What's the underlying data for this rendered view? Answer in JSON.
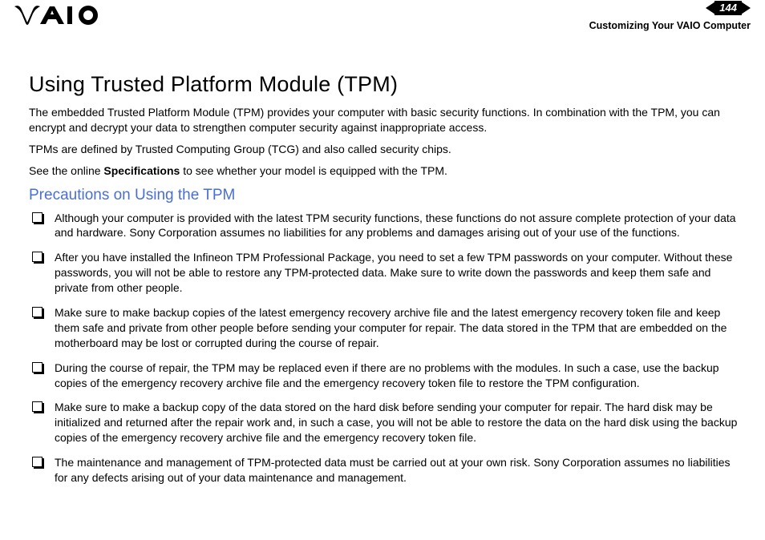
{
  "header": {
    "page_number": "144",
    "breadcrumb": "Customizing Your VAIO Computer"
  },
  "main": {
    "title": "Using Trusted Platform Module (TPM)",
    "intro1": "The embedded Trusted Platform Module (TPM) provides your computer with basic security functions. In combination with the TPM, you can encrypt and decrypt your data to strengthen computer security against inappropriate access.",
    "intro2": "TPMs are defined by Trusted Computing Group (TCG) and also called security chips.",
    "intro3_pre": "See the online ",
    "intro3_bold": "Specifications",
    "intro3_post": " to see whether your model is equipped with the TPM.",
    "subheading": "Precautions on Using the TPM",
    "bullets": [
      "Although your computer is provided with the latest TPM security functions, these functions do not assure complete protection of your data and hardware. Sony Corporation assumes no liabilities for any problems and damages arising out of your use of the functions.",
      "After you have installed the Infineon TPM Professional Package, you need to set a few TPM passwords on your computer. Without these passwords, you will not be able to restore any TPM-protected data. Make sure to write down the passwords and keep them safe and private from other people.",
      "Make sure to make backup copies of the latest emergency recovery archive file and the latest emergency recovery token file and keep them safe and private from other people before sending your computer for repair. The data stored in the TPM that are embedded on the motherboard may be lost or corrupted during the course of repair.",
      "During the course of repair, the TPM may be replaced even if there are no problems with the modules. In such a case, use the backup copies of the emergency recovery archive file and the emergency recovery token file to restore the TPM configuration.",
      "Make sure to make a backup copy of the data stored on the hard disk before sending your computer for repair. The hard disk may be initialized and returned after the repair work and, in such a case, you will not be able to restore the data on the hard disk using the backup copies of the emergency recovery archive file and the emergency recovery token file.",
      "The maintenance and management of TPM-protected data must be carried out at your own risk. Sony Corporation assumes no liabilities for any defects arising out of your data maintenance and management."
    ]
  }
}
